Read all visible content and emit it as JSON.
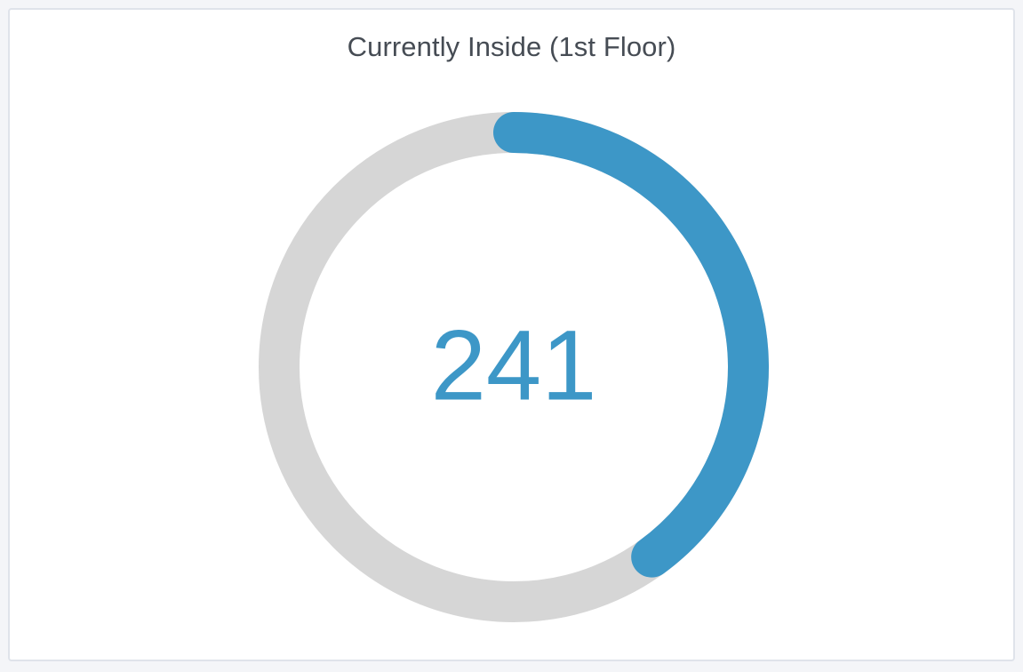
{
  "panel": {
    "title": "Currently Inside (1st Floor)"
  },
  "gauge": {
    "value": "241",
    "fraction": 0.4,
    "colors": {
      "fill": "#3d97c7",
      "track": "#d6d6d6",
      "text": "#3d97c7"
    }
  }
}
